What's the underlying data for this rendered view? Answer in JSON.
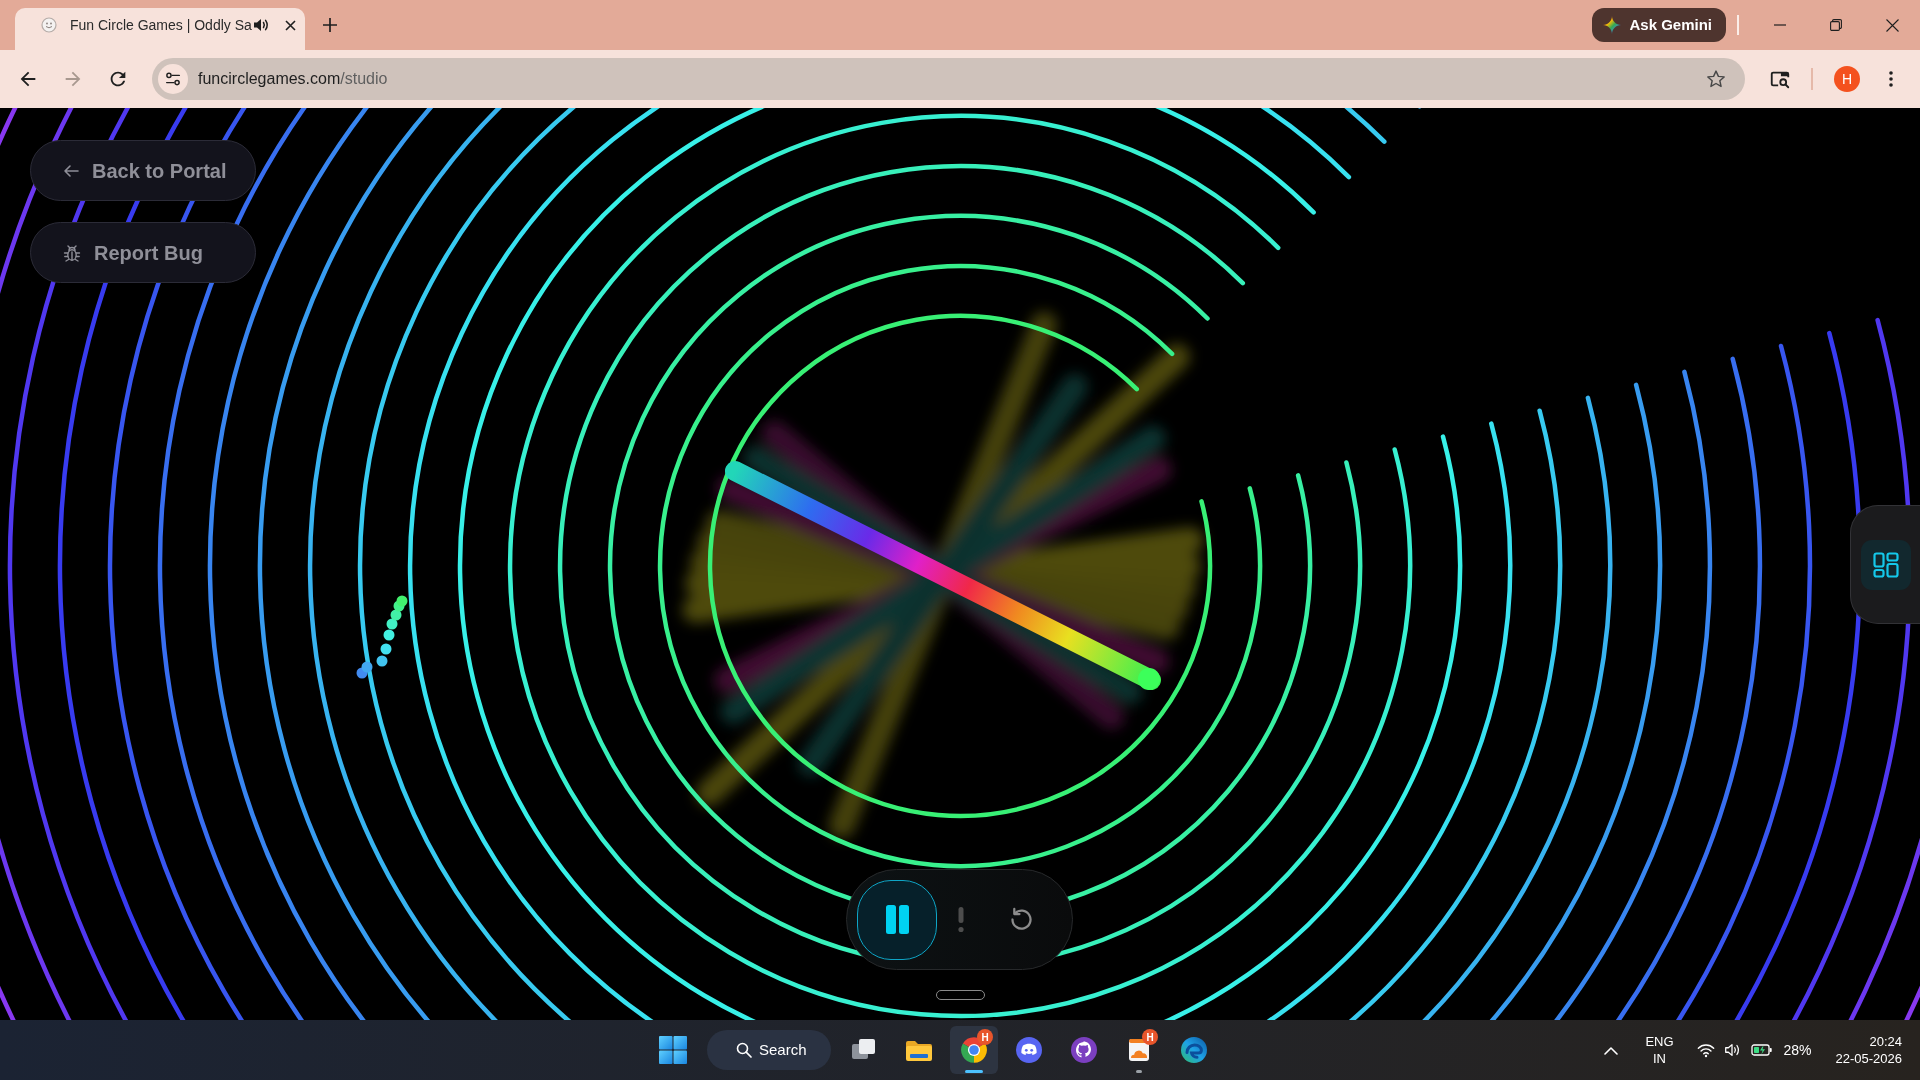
{
  "browser": {
    "tabs": [
      {
        "title": "Fun Circle Games | Oddly Sa",
        "selected": true,
        "audible": true
      }
    ],
    "ask_button": "Ask Gemini",
    "nav": [
      {
        "kind": "back",
        "disabled": false
      },
      {
        "kind": "forward",
        "disabled": true
      },
      {
        "kind": "reload",
        "disabled": false
      }
    ],
    "url": {
      "host": "funcirclegames.com",
      "path": "/studio"
    },
    "profile_initial": "H"
  },
  "page": {
    "buttons": [
      {
        "kind": "back",
        "label": "Back to Portal"
      },
      {
        "kind": "bug",
        "label": "Report Bug"
      }
    ],
    "player": {
      "playing": true
    }
  },
  "taskbar": {
    "search": "Search",
    "apps": [
      {
        "kind": "task-view",
        "open": false,
        "selected": false
      },
      {
        "kind": "folder",
        "open": false,
        "selected": false
      },
      {
        "kind": "chrome",
        "badge": "H",
        "open": true,
        "selected": true
      },
      {
        "kind": "discord",
        "open": false,
        "selected": false
      },
      {
        "kind": "github",
        "open": false,
        "selected": false
      },
      {
        "kind": "cloud",
        "badge": "H",
        "open": true,
        "selected": false
      },
      {
        "kind": "edge",
        "open": false,
        "selected": false
      }
    ],
    "tray": {
      "language": "ENG",
      "region": "IN",
      "battery": "28%",
      "time": "20:24",
      "date": "22-05-2026"
    }
  }
}
